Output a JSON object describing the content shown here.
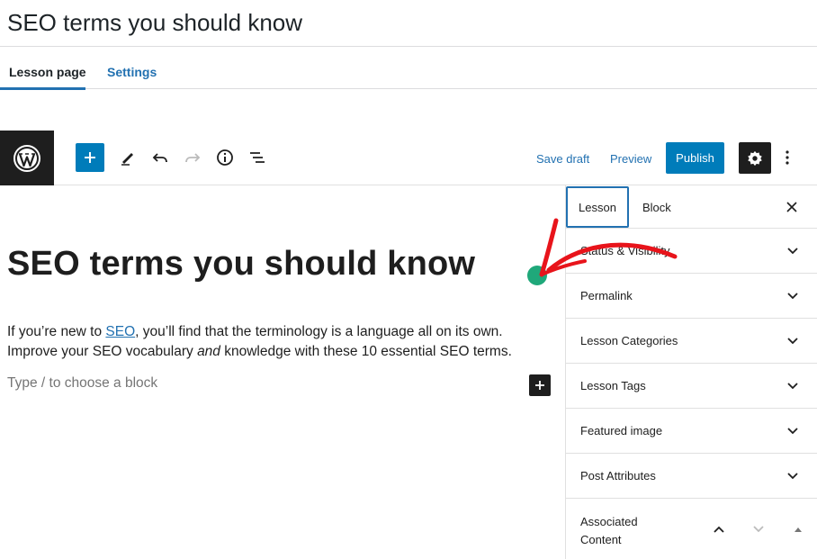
{
  "page": {
    "title": "SEO terms you should know"
  },
  "tabs": {
    "lesson_page": "Lesson page",
    "settings": "Settings"
  },
  "toolbar": {
    "save_draft": "Save draft",
    "preview": "Preview",
    "publish": "Publish",
    "icons": [
      "wordpress-logo-icon",
      "plus-icon",
      "pencil-icon",
      "undo-icon",
      "redo-icon",
      "info-icon",
      "list-view-icon",
      "gear-icon",
      "more-vertical-icon"
    ]
  },
  "content": {
    "heading": "SEO terms you should know",
    "para_part1": "If you’re new to ",
    "para_link": "SEO",
    "para_part2": ", you’ll find that the terminology is a language all on its own. Improve your SEO vocabulary ",
    "para_em": "and",
    "para_part3": " knowledge with these 10 essential SEO terms.",
    "block_placeholder": "Type / to choose a block"
  },
  "sidebar": {
    "tab_lesson": "Lesson",
    "tab_block": "Block",
    "panels": [
      {
        "label": "Status & Visibility"
      },
      {
        "label": "Permalink"
      },
      {
        "label": "Lesson Categories"
      },
      {
        "label": "Lesson Tags"
      },
      {
        "label": "Featured image"
      },
      {
        "label": "Post Attributes"
      }
    ],
    "associated_content": "Associated Content"
  },
  "colors": {
    "accent": "#007cba",
    "link": "#2271b1",
    "dark": "#1e1e1e",
    "annotation_red": "#e8141b",
    "green_dot": "#1fa87a"
  }
}
